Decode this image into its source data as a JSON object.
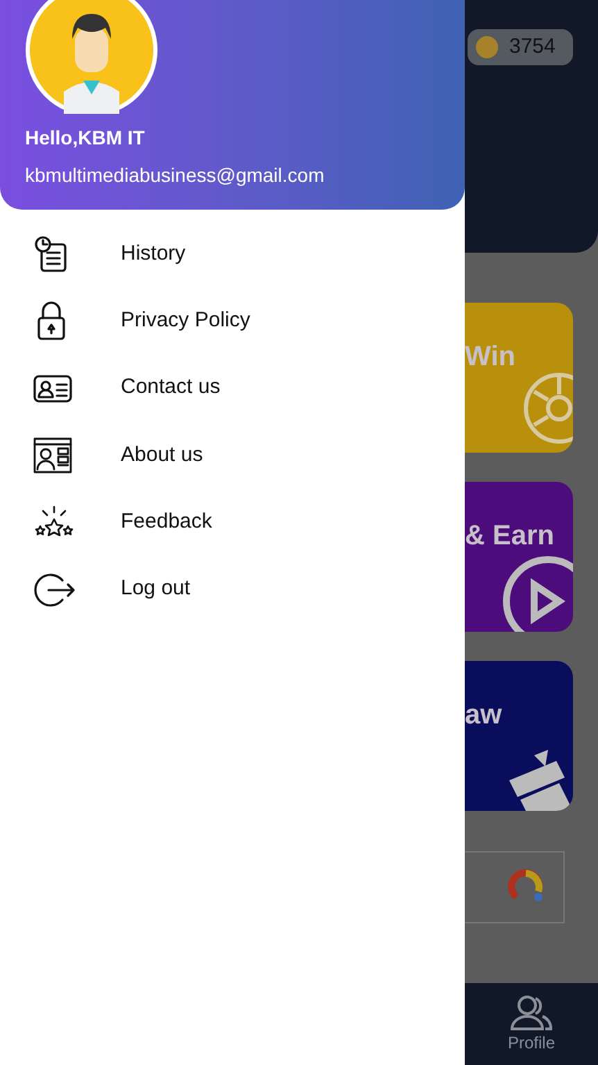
{
  "drawer": {
    "greeting": "Hello,KBM IT",
    "email": "kbmultimediabusiness@gmail.com",
    "items": [
      {
        "kind": "history",
        "label": "History"
      },
      {
        "kind": "privacy",
        "label": "Privacy Policy"
      },
      {
        "kind": "contact",
        "label": "Contact us"
      },
      {
        "kind": "about",
        "label": "About us"
      },
      {
        "kind": "feedback",
        "label": "Feedback"
      },
      {
        "kind": "logout",
        "label": "Log out"
      }
    ]
  },
  "background": {
    "coins": "3754",
    "cards": [
      {
        "kind": "spin",
        "title": "Win"
      },
      {
        "kind": "watch",
        "title": "& Earn"
      },
      {
        "kind": "draw",
        "title": "aw"
      }
    ],
    "nav": [
      {
        "label": "Profile"
      }
    ]
  }
}
